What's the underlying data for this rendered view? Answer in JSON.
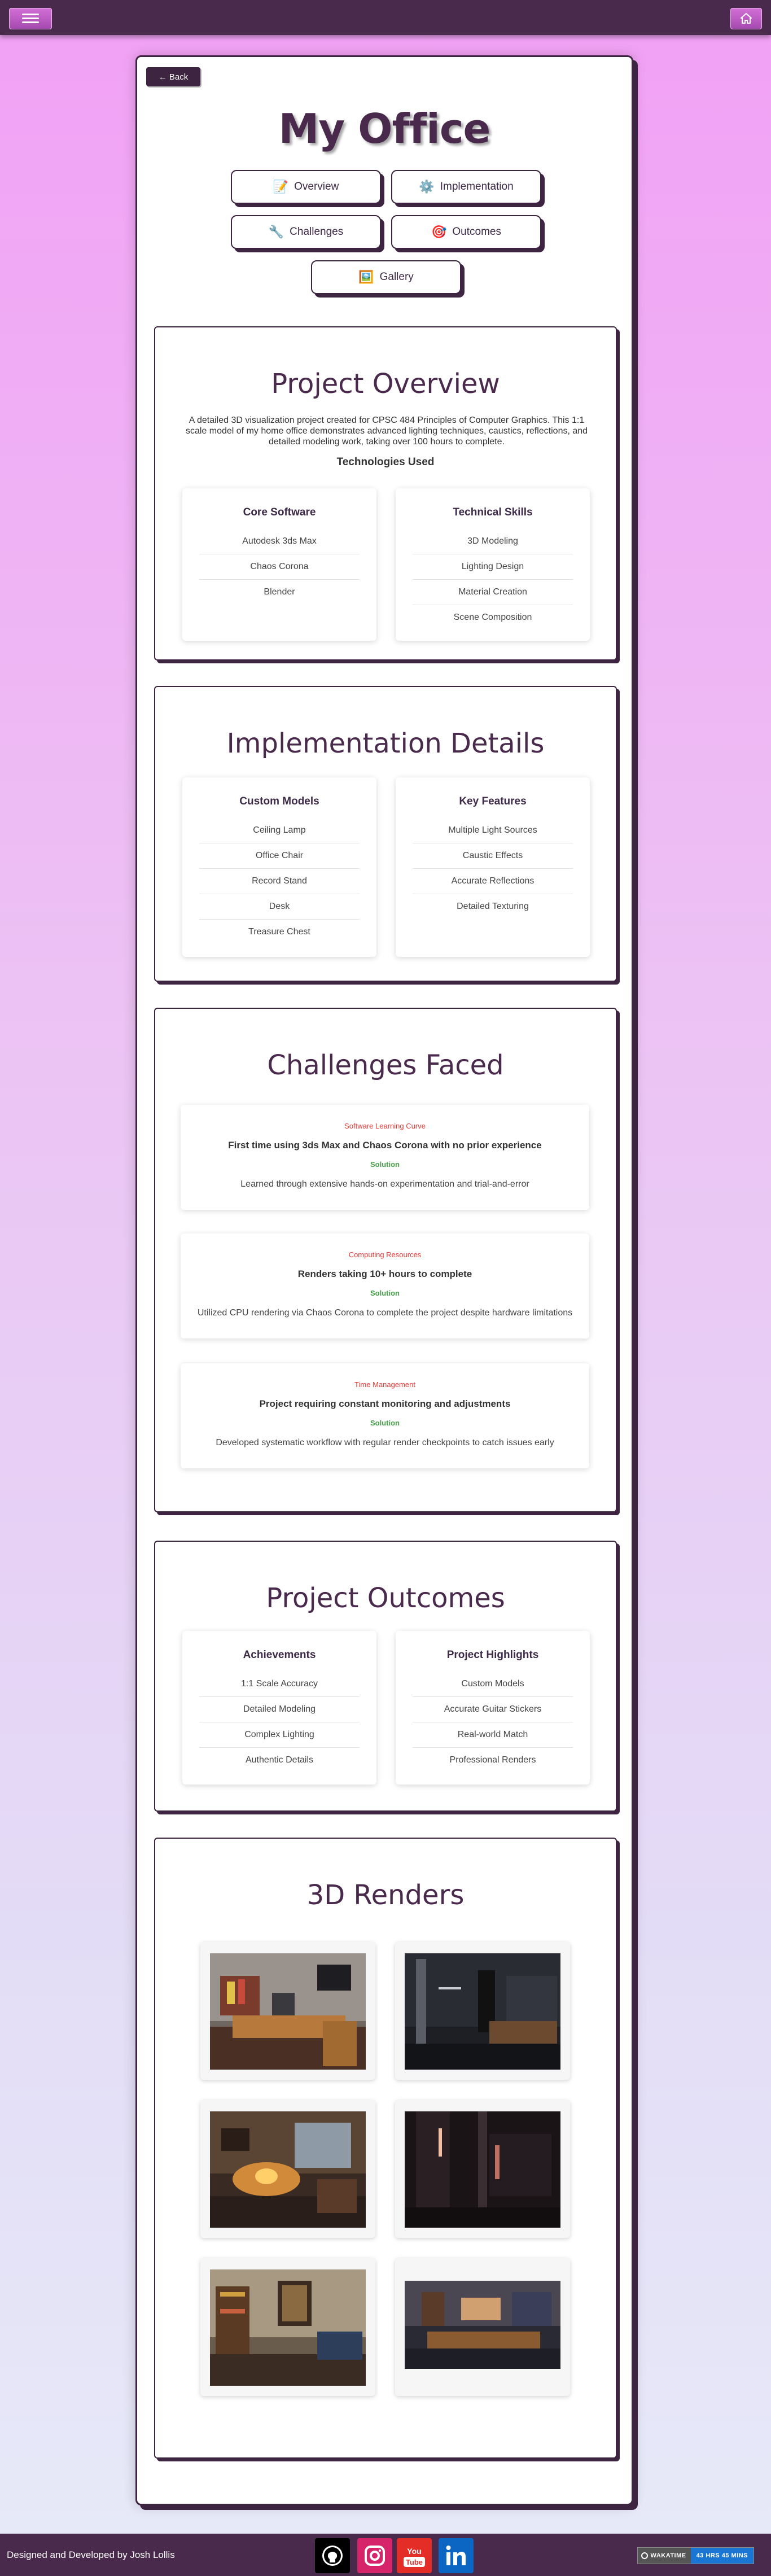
{
  "header": {
    "menu_icon": "hamburger-icon",
    "home_icon": "home-icon"
  },
  "back_label": "← Back",
  "page_title": "My Office",
  "nav": [
    {
      "label": "Overview",
      "icon": "📝"
    },
    {
      "label": "Implementation",
      "icon": "⚙️"
    },
    {
      "label": "Challenges",
      "icon": "🔧"
    },
    {
      "label": "Outcomes",
      "icon": "🎯"
    },
    {
      "label": "Gallery",
      "icon": "🖼️"
    }
  ],
  "overview": {
    "title": "Project Overview",
    "description": "A detailed 3D visualization project created for CPSC 484 Principles of Computer Graphics. This 1:1 scale model of my home office demonstrates advanced lighting techniques, caustics, reflections, and detailed modeling work, taking over 100 hours to complete.",
    "tech_heading": "Technologies Used",
    "cards": [
      {
        "title": "Core Software",
        "items": [
          "Autodesk 3ds Max",
          "Chaos Corona",
          "Blender"
        ]
      },
      {
        "title": "Technical Skills",
        "items": [
          "3D Modeling",
          "Lighting Design",
          "Material Creation",
          "Scene Composition"
        ]
      }
    ]
  },
  "implementation": {
    "title": "Implementation Details",
    "cards": [
      {
        "title": "Custom Models",
        "items": [
          "Ceiling Lamp",
          "Office Chair",
          "Record Stand",
          "Desk",
          "Treasure Chest"
        ]
      },
      {
        "title": "Key Features",
        "items": [
          "Multiple Light Sources",
          "Caustic Effects",
          "Accurate Reflections",
          "Detailed Texturing"
        ]
      }
    ]
  },
  "challenges": {
    "title": "Challenges Faced",
    "solution_label": "Solution",
    "items": [
      {
        "category": "Software Learning Curve",
        "problem": "First time using 3ds Max and Chaos Corona with no prior experience",
        "solution": "Learned through extensive hands-on experimentation and trial-and-error"
      },
      {
        "category": "Computing Resources",
        "problem": "Renders taking 10+ hours to complete",
        "solution": "Utilized CPU rendering via Chaos Corona to complete the project despite hardware limitations"
      },
      {
        "category": "Time Management",
        "problem": "Project requiring constant monitoring and adjustments",
        "solution": "Developed systematic workflow with regular render checkpoints to catch issues early"
      }
    ]
  },
  "outcomes": {
    "title": "Project Outcomes",
    "cards": [
      {
        "title": "Achievements",
        "items": [
          "1:1 Scale Accuracy",
          "Detailed Modeling",
          "Complex Lighting",
          "Authentic Details"
        ]
      },
      {
        "title": "Project Highlights",
        "items": [
          "Custom Models",
          "Accurate Guitar Stickers",
          "Real-world Match",
          "Professional Renders"
        ]
      }
    ]
  },
  "gallery": {
    "title": "3D Renders"
  },
  "footer": {
    "credit": "Designed and Developed by Josh Lollis",
    "social": [
      "github-icon",
      "instagram-icon",
      "youtube-icon",
      "linkedin-icon"
    ],
    "badge_label": "WAKATIME",
    "badge_value": "43 HRS 45 MINS"
  }
}
